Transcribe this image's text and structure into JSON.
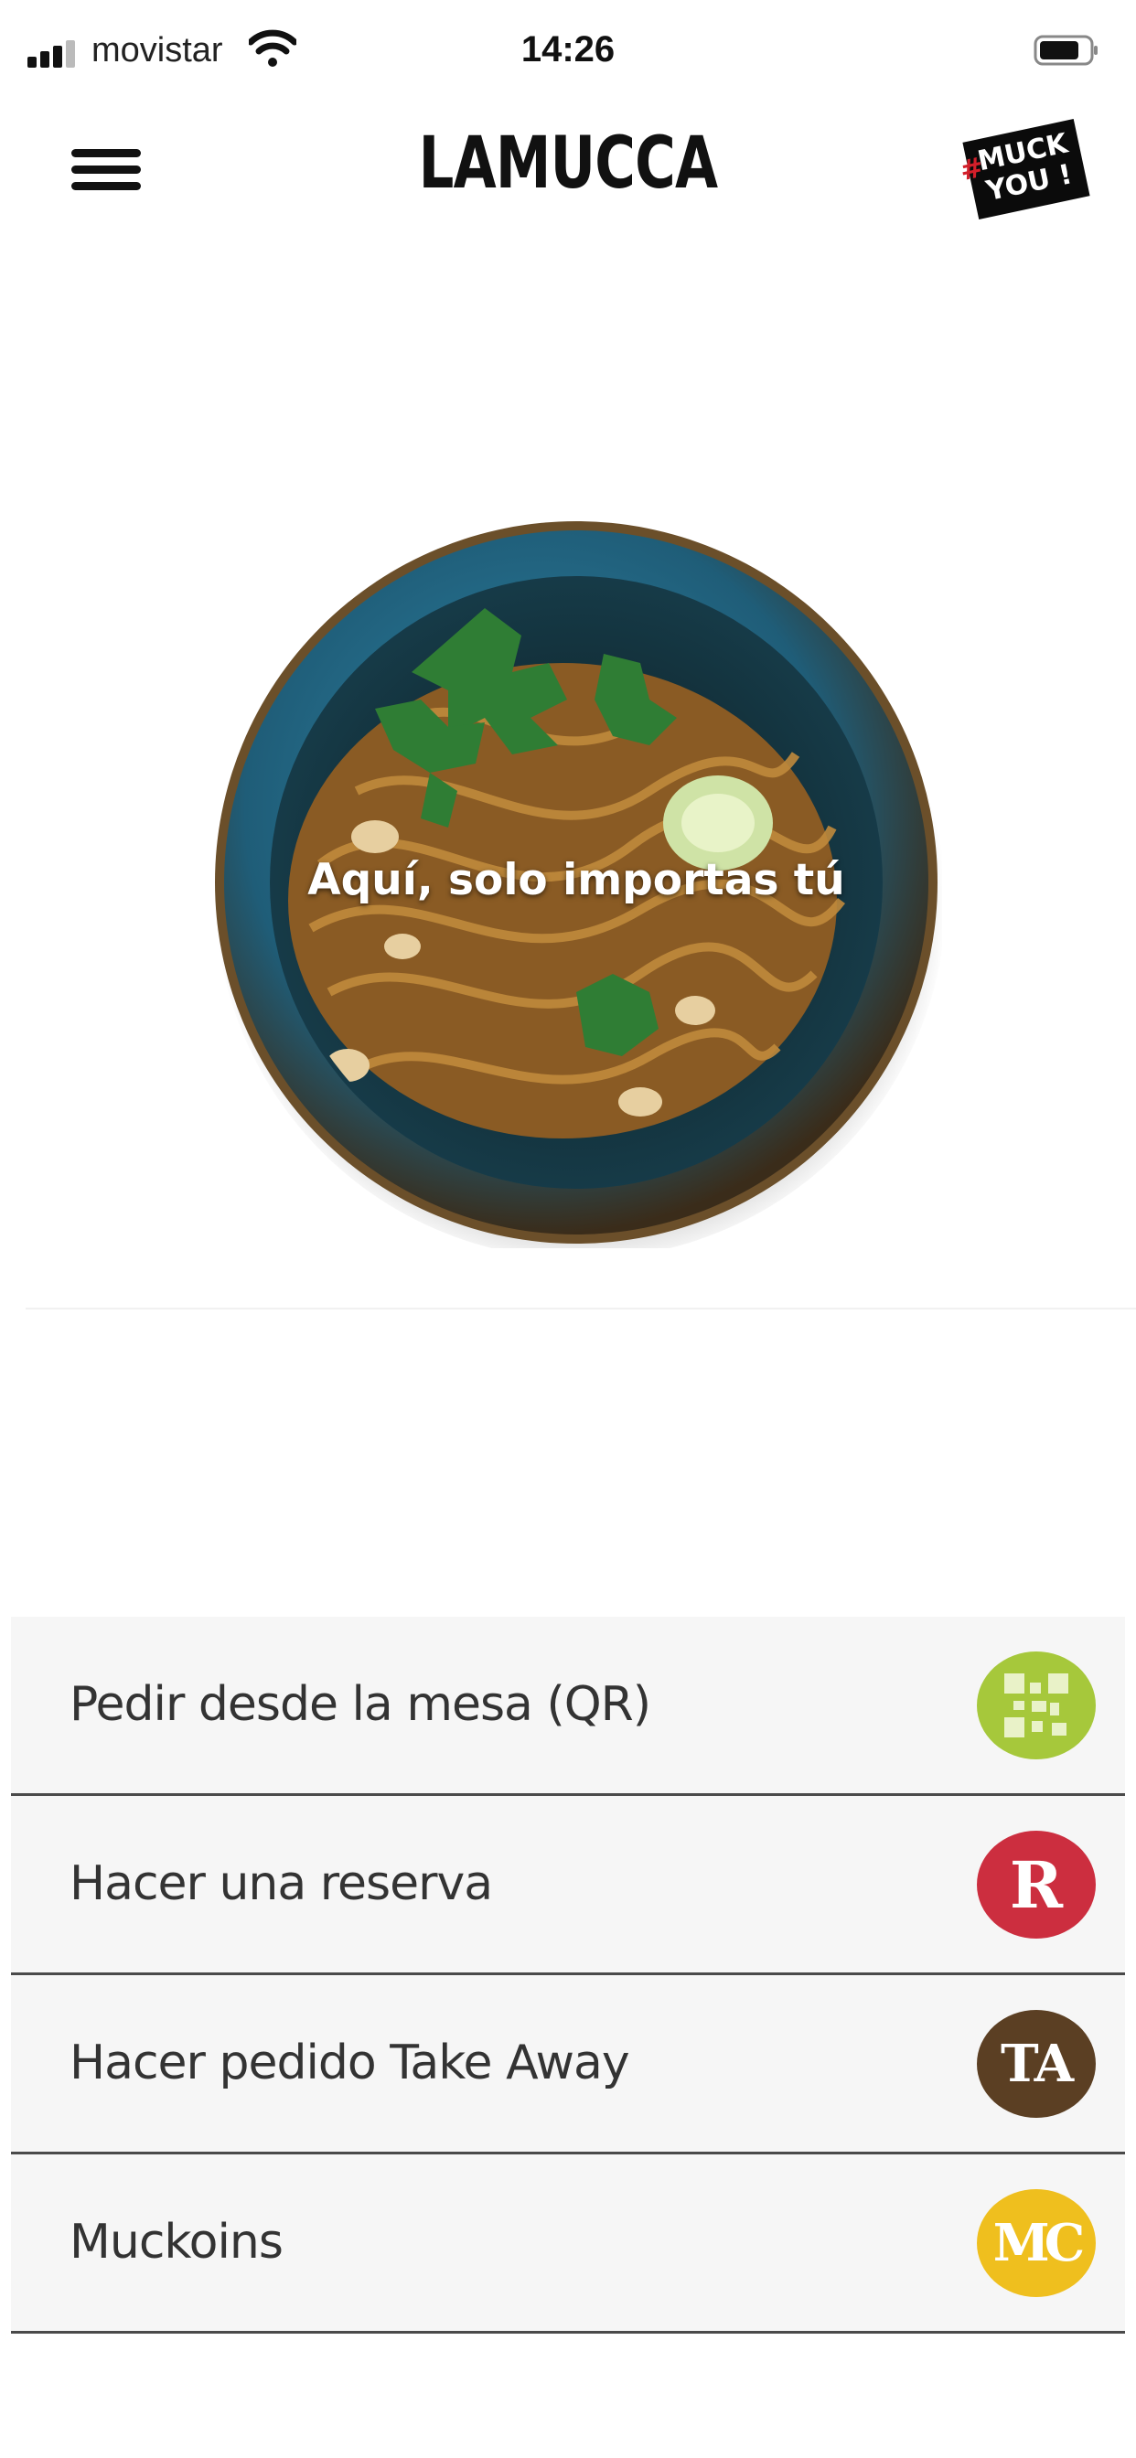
{
  "status_bar": {
    "carrier": "movistar",
    "time": "14:26"
  },
  "header": {
    "brand": "LAMUCCA",
    "badge_hash": "#",
    "badge_line1": "MUCK",
    "badge_line2": "YOU !"
  },
  "hero": {
    "tagline": "Aquí, solo importas tú"
  },
  "actions": [
    {
      "label": "Pedir desde la mesa (QR)",
      "icon": "qr-code-icon",
      "icon_text": "",
      "color": "#a6c83b"
    },
    {
      "label": "Hacer una reserva",
      "icon": "reserva-r-icon",
      "icon_text": "R",
      "color": "#cc2e3f"
    },
    {
      "label": "Hacer pedido Take Away",
      "icon": "take-away-ta-icon",
      "icon_text": "TA",
      "color": "#5b3f23"
    },
    {
      "label": "Muckoins",
      "icon": "muckoins-mc-icon",
      "icon_text": "MC",
      "color": "#efbf1e"
    }
  ],
  "colors": {
    "background": "#ffffff",
    "row_background": "#f6f6f6",
    "row_divider": "#4a4a4a",
    "bowl_blue": "#2d6f8c"
  }
}
